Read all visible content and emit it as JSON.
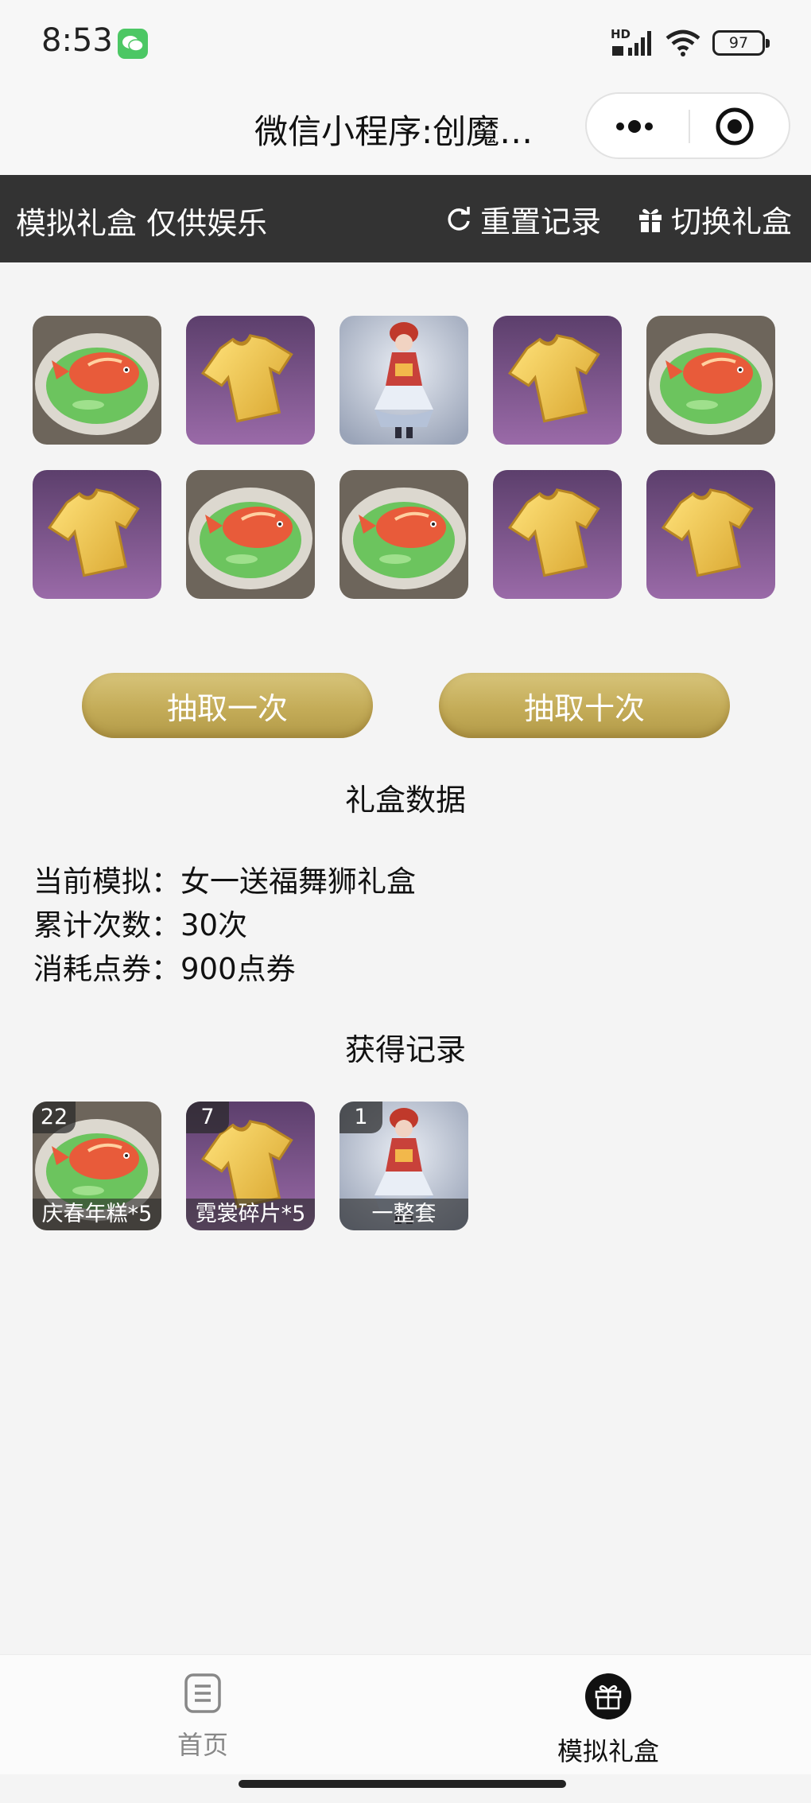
{
  "status_bar": {
    "time": "8:53",
    "network": "HD",
    "battery": "97"
  },
  "nav": {
    "title": "微信小程序:创魔…"
  },
  "header": {
    "title": "模拟礼盒 仅供娱乐",
    "reset_label": "重置记录",
    "switch_label": "切换礼盒"
  },
  "grid": {
    "rows": [
      [
        {
          "item": "fish-dish"
        },
        {
          "item": "gold-shirt"
        },
        {
          "item": "costume-figure"
        },
        {
          "item": "gold-shirt"
        },
        {
          "item": "fish-dish"
        }
      ],
      [
        {
          "item": "gold-shirt"
        },
        {
          "item": "fish-dish"
        },
        {
          "item": "fish-dish"
        },
        {
          "item": "gold-shirt"
        },
        {
          "item": "gold-shirt"
        }
      ]
    ]
  },
  "buttons": {
    "draw_once": "抽取一次",
    "draw_ten": "抽取十次"
  },
  "stats": {
    "title": "礼盒数据",
    "current_label": "当前模拟：",
    "current_value": "女一送福舞狮礼盒",
    "count_label": "累计次数：",
    "count_value": "30次",
    "cost_label": "消耗点券：",
    "cost_value": "900点券"
  },
  "records": {
    "title": "获得记录",
    "items": [
      {
        "count": "22",
        "label": "庆春年糕*5",
        "item": "fish-dish"
      },
      {
        "count": "7",
        "label": "霓裳碎片*5",
        "item": "gold-shirt"
      },
      {
        "count": "1",
        "label": "一整套",
        "item": "costume-figure"
      }
    ]
  },
  "tabbar": {
    "home_label": "首页",
    "gift_label": "模拟礼盒",
    "active": "gift"
  },
  "colors": {
    "dark_header": "#333333",
    "gold_button": "#c4ac58",
    "purple_tile": "#7a5590",
    "wechat_green": "#4cc764"
  }
}
